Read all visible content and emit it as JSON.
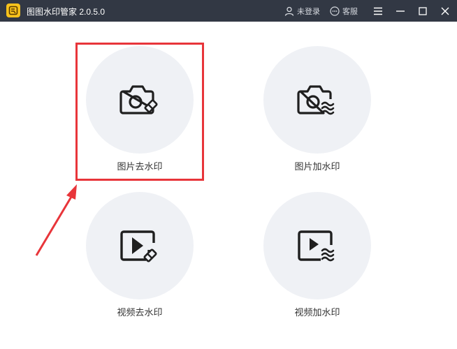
{
  "app": {
    "title": "图图水印管家  2.0.5.0",
    "logo_icon": "app-logo-icon",
    "brand_color": "#f7c21c",
    "titlebar_color": "#323844"
  },
  "titlebar": {
    "login_label": "未登录",
    "service_label": "客服",
    "icons": [
      "user-icon",
      "chat-icon",
      "menu-icon",
      "minimize-icon",
      "maximize-icon",
      "close-icon"
    ]
  },
  "tiles": [
    {
      "label": "图片去水印",
      "icon": "camera-eraser-icon"
    },
    {
      "label": "图片加水印",
      "icon": "camera-watermark-icon"
    },
    {
      "label": "视频去水印",
      "icon": "video-eraser-icon"
    },
    {
      "label": "视频加水印",
      "icon": "video-watermark-icon"
    }
  ],
  "annotation": {
    "highlight_color": "#e8353a",
    "highlighted_tile": "图片去水印"
  }
}
